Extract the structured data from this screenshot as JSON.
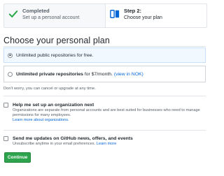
{
  "steps": [
    {
      "title": "Completed",
      "subtitle": "Set up a personal account",
      "state": "completed",
      "icon": "check-icon"
    },
    {
      "title": "Step 2:",
      "subtitle": "Choose your plan",
      "state": "current",
      "icon": "plan-icon"
    }
  ],
  "heading": "Choose your personal plan",
  "plans": [
    {
      "label": "Unlimited public repositories for free.",
      "selected": true
    },
    {
      "label_bold": "Unlimited private repositories",
      "label_rest": " for $7/month.",
      "link": "(view in NOK)",
      "selected": false
    }
  ],
  "note": "Don't worry, you can cancel or upgrade at any time.",
  "org_option": {
    "title": "Help me set up an organization next",
    "description": "Organizations are separate from personal accounts and are best suited for businesses who need to manage permissions for many employees.",
    "link": "Learn more about organizations."
  },
  "updates_option": {
    "title": "Send me updates on GitHub news, offers, and events",
    "description": "Unsubscribe anytime in your email preferences.",
    "link": "Learn more"
  },
  "continue_label": "Continue",
  "colors": {
    "accent_green": "#2ea44f",
    "link_blue": "#0366d6",
    "selected_bg": "#f1f8ff"
  }
}
